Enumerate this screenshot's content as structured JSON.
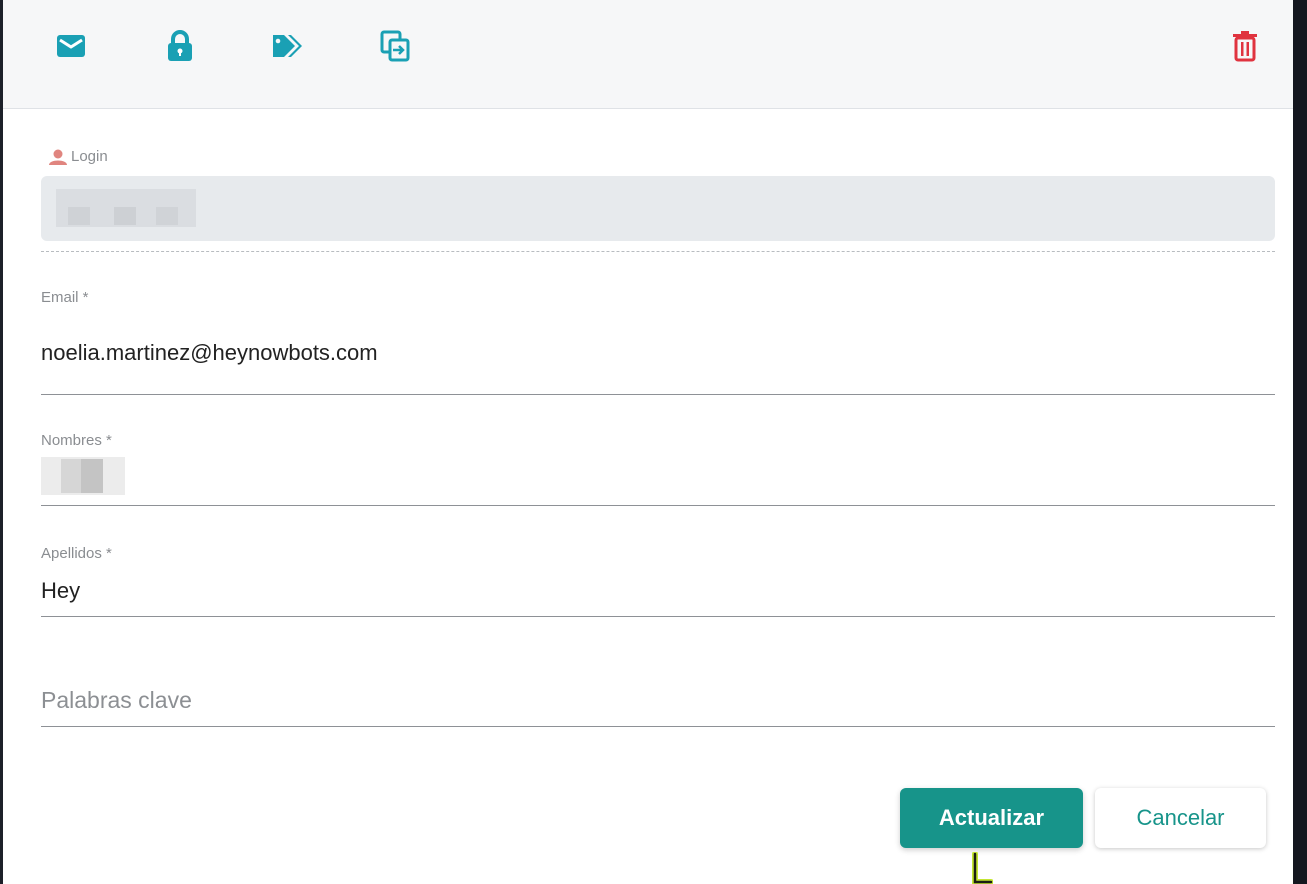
{
  "toolbar": {
    "icons": [
      "email-icon",
      "lock-icon",
      "tags-icon",
      "switch-icon",
      "trash-icon"
    ],
    "accent_color": "#1aa0b4",
    "danger_color": "#e0333f"
  },
  "form": {
    "login": {
      "label": "Login",
      "value": ""
    },
    "email": {
      "label": "Email *",
      "value": "noelia.martinez@heynowbots.com"
    },
    "nombres": {
      "label": "Nombres *",
      "value": ""
    },
    "apellidos": {
      "label": "Apellidos *",
      "value": "Hey"
    },
    "keywords": {
      "placeholder": "Palabras clave",
      "value": ""
    }
  },
  "actions": {
    "update_label": "Actualizar",
    "cancel_label": "Cancelar",
    "primary_color": "#17948a"
  }
}
